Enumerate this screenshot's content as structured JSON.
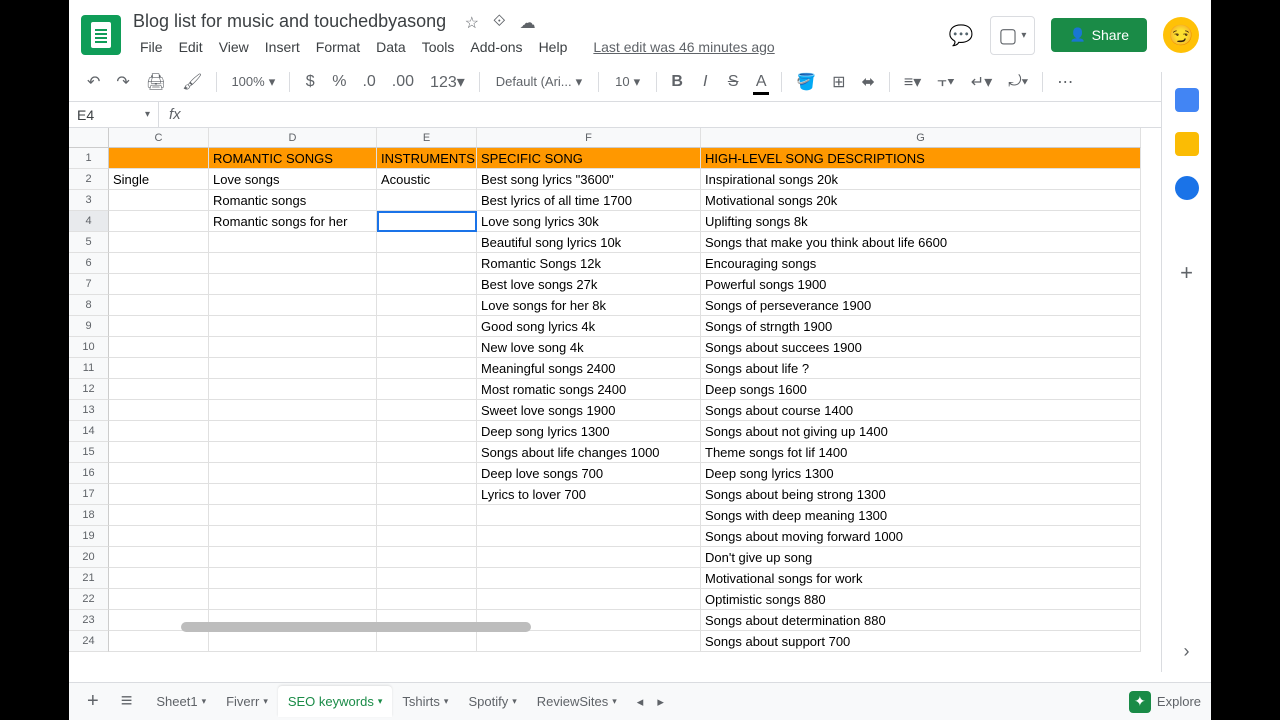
{
  "doc_title": "Blog list for music and touchedbyasong",
  "last_edit": "Last edit was 46 minutes ago",
  "menu": [
    "File",
    "Edit",
    "View",
    "Insert",
    "Format",
    "Data",
    "Tools",
    "Add-ons",
    "Help"
  ],
  "share": "Share",
  "toolbar": {
    "zoom": "100%",
    "font": "Default (Ari...",
    "size": "10"
  },
  "name_box": "E4",
  "columns": [
    "",
    "C",
    "D",
    "E",
    "F",
    "G"
  ],
  "headers": {
    "c": "",
    "d": "ROMANTIC SONGS",
    "e": "INSTRUMENTS",
    "f": "SPECIFIC SONG",
    "g": "HIGH-LEVEL SONG DESCRIPTIONS"
  },
  "rows": [
    {
      "n": 2,
      "c": "Single",
      "d": "Love songs",
      "e": "Acoustic",
      "f": "Best song lyrics \"3600\"",
      "g": "Inspirational songs 20k"
    },
    {
      "n": 3,
      "c": "",
      "d": "Romantic songs",
      "e": "",
      "f": "Best lyrics of all time 1700",
      "g": "Motivational songs 20k"
    },
    {
      "n": 4,
      "c": "",
      "d": "Romantic songs for her",
      "e": "",
      "f": "Love song lyrics 30k",
      "g": "Uplifting songs 8k"
    },
    {
      "n": 5,
      "c": "",
      "d": "",
      "e": "",
      "f": "Beautiful song lyrics 10k",
      "g": "Songs that make you think about life 6600"
    },
    {
      "n": 6,
      "c": "",
      "d": "",
      "e": "",
      "f": "Romantic Songs 12k",
      "g": "Encouraging songs"
    },
    {
      "n": 7,
      "c": "",
      "d": "",
      "e": "",
      "f": "Best love songs 27k",
      "g": "Powerful songs 1900"
    },
    {
      "n": 8,
      "c": "",
      "d": "",
      "e": "",
      "f": "Love songs for her 8k",
      "g": "Songs of perseverance 1900"
    },
    {
      "n": 9,
      "c": "",
      "d": "",
      "e": "",
      "f": "Good song lyrics 4k",
      "g": "Songs of strngth 1900"
    },
    {
      "n": 10,
      "c": "",
      "d": "",
      "e": "",
      "f": "New love song 4k",
      "g": "Songs about succees 1900"
    },
    {
      "n": 11,
      "c": "",
      "d": "",
      "e": "",
      "f": "Meaningful songs 2400",
      "g": "Songs about life ?"
    },
    {
      "n": 12,
      "c": "",
      "d": "",
      "e": "",
      "f": "Most romatic songs 2400",
      "g": "Deep songs 1600"
    },
    {
      "n": 13,
      "c": "",
      "d": "",
      "e": "",
      "f": "Sweet love songs 1900",
      "g": "Songs about course 1400"
    },
    {
      "n": 14,
      "c": "",
      "d": "",
      "e": "",
      "f": "Deep song lyrics 1300",
      "g": "Songs about not giving up 1400"
    },
    {
      "n": 15,
      "c": "",
      "d": "",
      "e": "",
      "f": "Songs about life changes 1000",
      "g": "Theme songs fot lif 1400"
    },
    {
      "n": 16,
      "c": "",
      "d": "",
      "e": "",
      "f": "Deep love songs 700",
      "g": "Deep song lyrics 1300"
    },
    {
      "n": 17,
      "c": "",
      "d": "",
      "e": "",
      "f": "Lyrics to lover 700",
      "g": "Songs about being strong 1300"
    },
    {
      "n": 18,
      "c": "",
      "d": "",
      "e": "",
      "f": "",
      "g": "Songs with deep meaning 1300"
    },
    {
      "n": 19,
      "c": "",
      "d": "",
      "e": "",
      "f": "",
      "g": "Songs about moving forward 1000"
    },
    {
      "n": 20,
      "c": "",
      "d": "",
      "e": "",
      "f": "",
      "g": "Don't give up song"
    },
    {
      "n": 21,
      "c": "",
      "d": "",
      "e": "",
      "f": "",
      "g": "Motivational songs for work"
    },
    {
      "n": 22,
      "c": "",
      "d": "",
      "e": "",
      "f": "",
      "g": "Optimistic songs 880"
    },
    {
      "n": 23,
      "c": "",
      "d": "",
      "e": "",
      "f": "",
      "g": "Songs about determination 880"
    },
    {
      "n": 24,
      "c": "",
      "d": "",
      "e": "",
      "f": "",
      "g": "Songs about support 700"
    }
  ],
  "tabs": [
    "Sheet1",
    "Fiverr",
    "SEO keywords",
    "Tshirts",
    "Spotify",
    "ReviewSites"
  ],
  "active_tab": 2,
  "explore": "Explore"
}
